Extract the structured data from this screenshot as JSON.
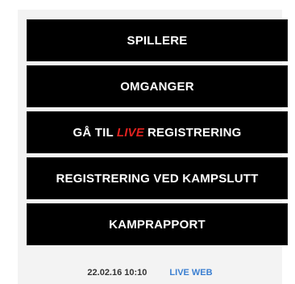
{
  "menu": {
    "players_label": "SPILLERE",
    "rounds_label": "OMGANGER",
    "goto_prefix": "GÅ TIL",
    "goto_live": "LIVE",
    "goto_suffix": "REGISTRERING",
    "post_match_label": "REGISTRERING VED KAMPSLUTT",
    "report_label": "KAMPRAPPORT"
  },
  "footer": {
    "timestamp": "22.02.16 10:10",
    "live_web_label": "LIVE WEB"
  },
  "colors": {
    "button_bg": "#000000",
    "button_text": "#ffffff",
    "live_accent": "#e0221f",
    "link": "#3b7fd1",
    "panel_bg": "#f3f3f3"
  }
}
